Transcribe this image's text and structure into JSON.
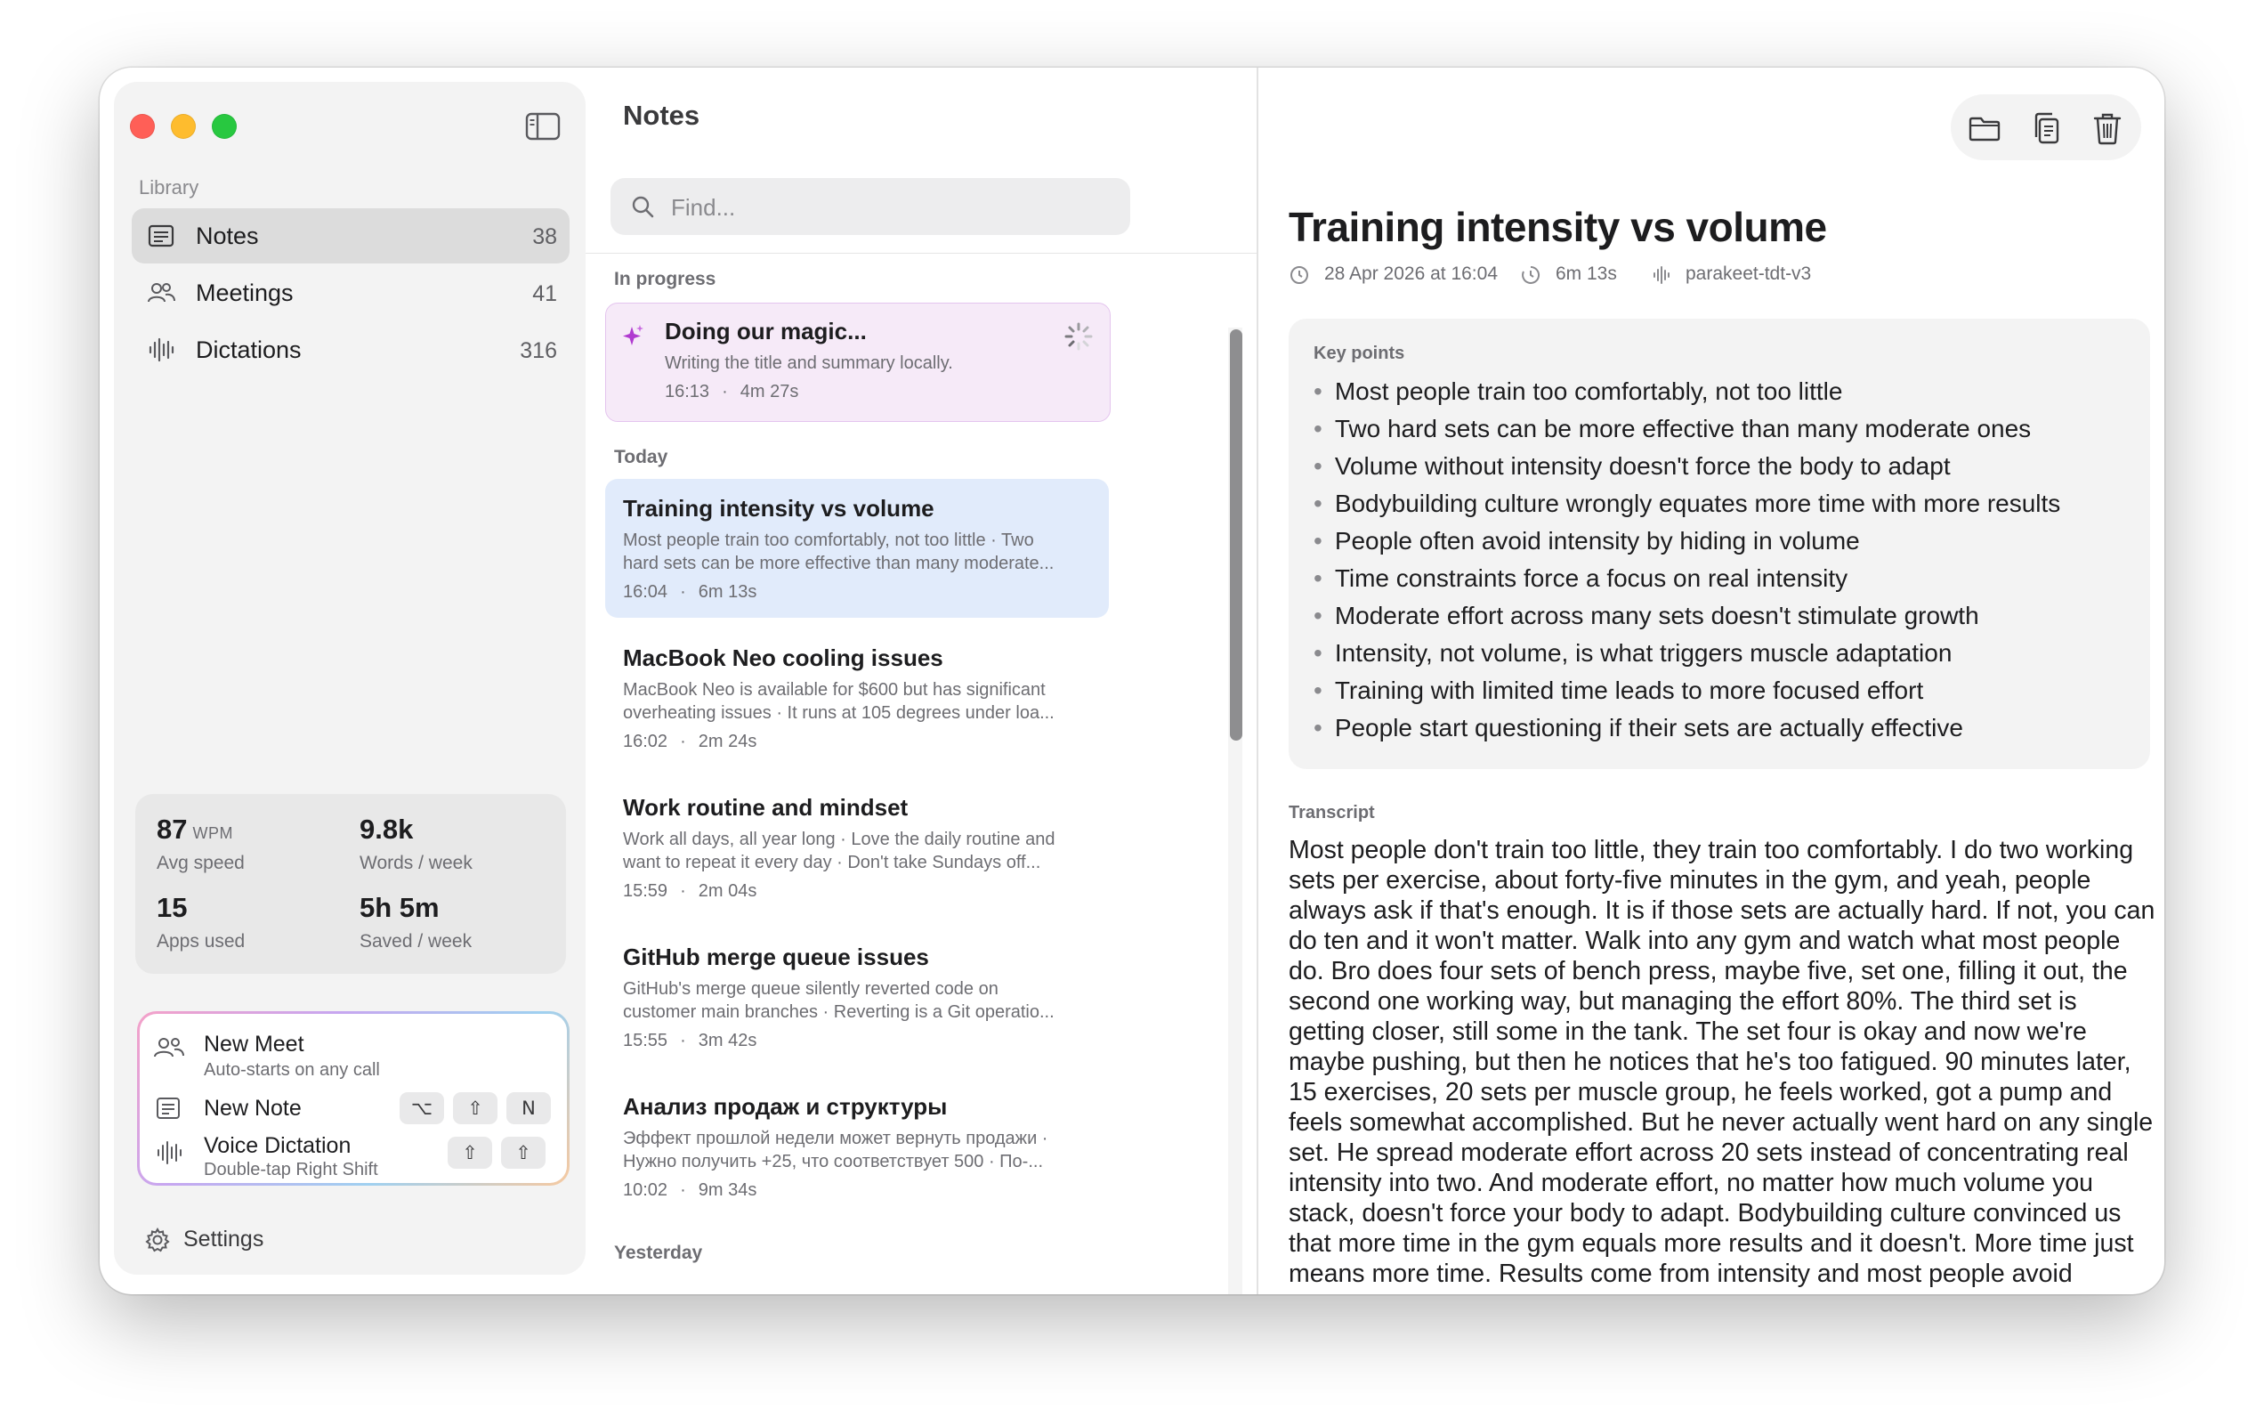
{
  "sidebar": {
    "section_label": "Library",
    "items": [
      {
        "label": "Notes",
        "count": "38",
        "icon": "note-icon"
      },
      {
        "label": "Meetings",
        "count": "41",
        "icon": "people-icon"
      },
      {
        "label": "Dictations",
        "count": "316",
        "icon": "waveform-icon"
      }
    ],
    "stats": {
      "avg_speed_value": "87",
      "avg_speed_unit": "WPM",
      "avg_speed_label": "Avg speed",
      "words_value": "9.8k",
      "words_label": "Words / week",
      "apps_value": "15",
      "apps_label": "Apps used",
      "saved_value": "5h 5m",
      "saved_label": "Saved / week"
    },
    "quick_actions": {
      "new_meet_title": "New Meet",
      "new_meet_sub": "Auto-starts on any call",
      "new_note_title": "New Note",
      "new_note_keys": [
        "⌥",
        "⇧",
        "N"
      ],
      "voice_title": "Voice Dictation",
      "voice_sub": "Double-tap Right Shift",
      "voice_keys": [
        "⇧",
        "⇧"
      ]
    },
    "settings_label": "Settings"
  },
  "list": {
    "title": "Notes",
    "search_placeholder": "Find...",
    "groups": {
      "in_progress": "In progress",
      "today": "Today",
      "yesterday": "Yesterday"
    },
    "in_progress_card": {
      "title": "Doing our magic...",
      "subtitle": "Writing the title and summary locally.",
      "time": "16:13",
      "duration": "4m 27s"
    },
    "notes": [
      {
        "title": "Training intensity vs volume",
        "preview1": "Most people train too comfortably, not too little · Two",
        "preview2": "hard sets can be more effective than many moderate...",
        "time": "16:04",
        "duration": "6m 13s"
      },
      {
        "title": "MacBook Neo cooling issues",
        "preview1": "MacBook Neo is available for $600 but has significant",
        "preview2": "overheating issues · It runs at 105 degrees under loa...",
        "time": "16:02",
        "duration": "2m 24s"
      },
      {
        "title": "Work routine and mindset",
        "preview1": "Work all days, all year long · Love the daily routine and",
        "preview2": "want to repeat it every day · Don't take Sundays off...",
        "time": "15:59",
        "duration": "2m 04s"
      },
      {
        "title": "GitHub merge queue issues",
        "preview1": "GitHub's merge queue silently reverted code on",
        "preview2": "customer main branches · Reverting is a Git operatio...",
        "time": "15:55",
        "duration": "3m 42s"
      },
      {
        "title": "Анализ продаж и структуры",
        "preview1": "Эффект прошлой недели может вернуть продажи ·",
        "preview2": "Нужно получить +25, что соответствует 500 · По-...",
        "time": "10:02",
        "duration": "9m 34s"
      }
    ]
  },
  "detail": {
    "title": "Training intensity vs volume",
    "date": "28 Apr 2026 at 16:04",
    "duration": "6m 13s",
    "model": "parakeet-tdt-v3",
    "key_points_label": "Key points",
    "key_points": [
      "Most people train too comfortably, not too little",
      "Two hard sets can be more effective than many moderate ones",
      "Volume without intensity doesn't force the body to adapt",
      "Bodybuilding culture wrongly equates more time with more results",
      "People often avoid intensity by hiding in volume",
      "Time constraints force a focus on real intensity",
      "Moderate effort across many sets doesn't stimulate growth",
      "Intensity, not volume, is what triggers muscle adaptation",
      "Training with limited time leads to more focused effort",
      "People start questioning if their sets are actually effective"
    ],
    "transcript_label": "Transcript",
    "transcript_lines": [
      "Most people don't train too little, they train too comfortably. I do two working",
      "sets per exercise, about forty-five minutes in the gym, and yeah, people",
      "always ask if that's enough. It is if those sets are actually hard. If not, you can",
      "do ten and it won't matter. Walk into any gym and watch what most people",
      "do. Bro does four sets of bench press, maybe five, set one, filling it out, the",
      "second one working way, but managing the effort 80%. The third set is",
      "getting closer, still some in the tank. The set four is okay and now we're",
      "maybe pushing, but then he notices that he's too fatigued. 90 minutes later,",
      "15 exercises, 20 sets per muscle group, he feels worked, got a pump and",
      "feels somewhat accomplished. But he never actually went hard on any single",
      "set. He spread moderate effort across 20 sets instead of concentrating real",
      "intensity into two. And moderate effort, no matter how much volume you",
      "stack, doesn't force your body to adapt. Bodybuilding culture convinced us",
      "that more time in the gym equals more results and it doesn't. More time just",
      "means more time. Results come from intensity and most people avoid"
    ]
  }
}
